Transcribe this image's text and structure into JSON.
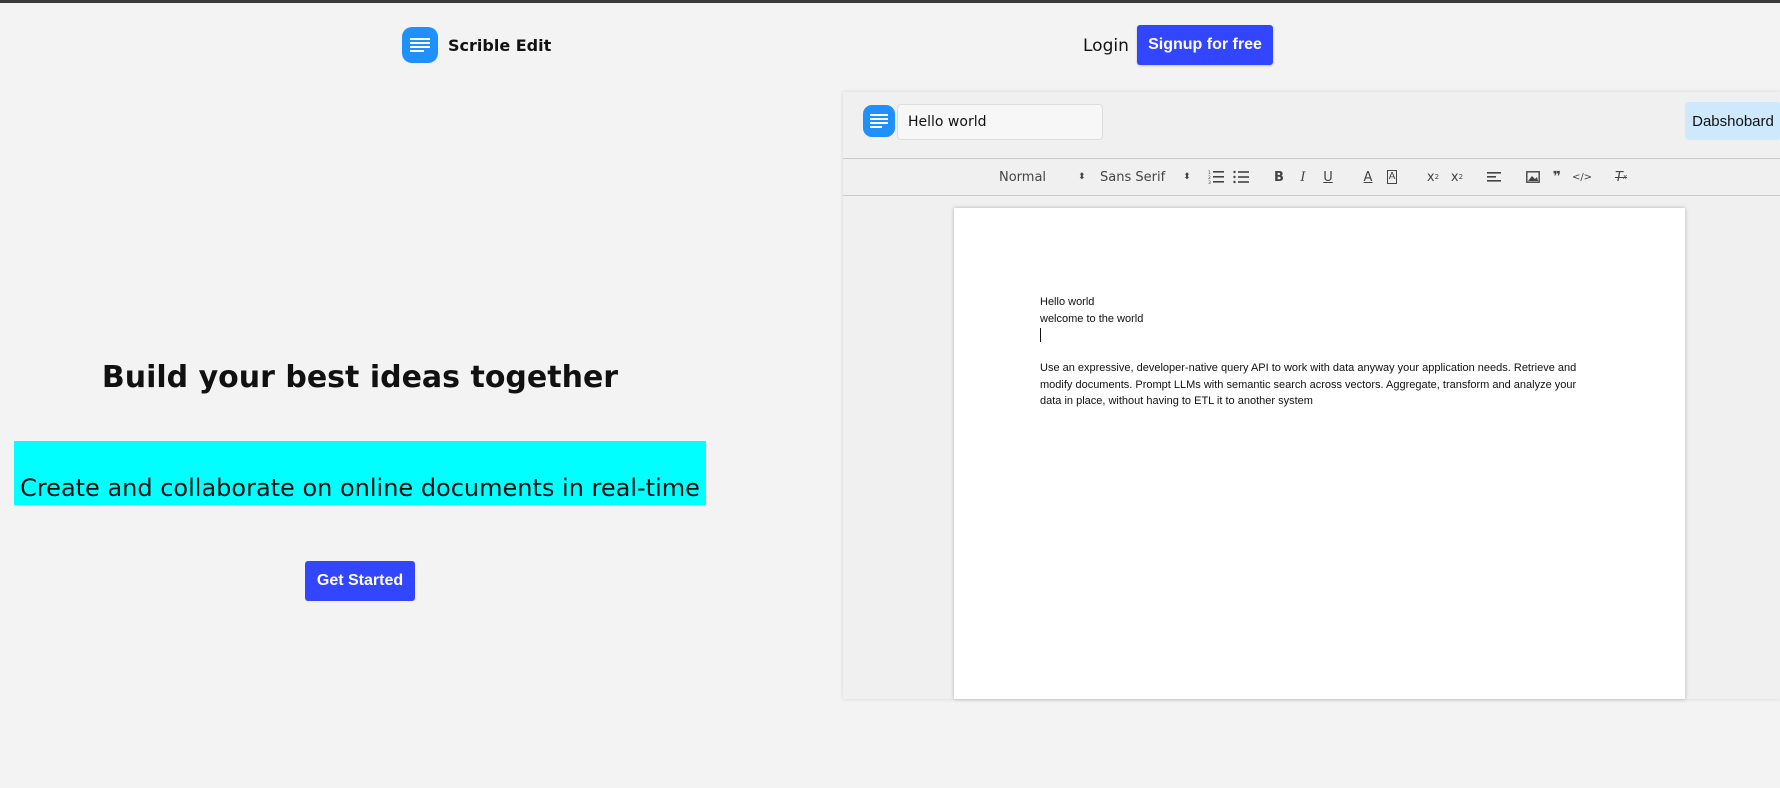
{
  "nav": {
    "brand": "Scrible Edit",
    "login": "Login",
    "signup": "Signup for free"
  },
  "hero": {
    "title": "Build your best ideas together",
    "subtitle": "Create and collaborate on online documents in real-time",
    "cta": "Get Started"
  },
  "editor": {
    "title_value": "Hello world",
    "dashboard": "Dabshobard",
    "toolbar": {
      "heading": "Normal",
      "font": "Sans Serif",
      "icons": [
        "ordered-list-icon",
        "bullet-list-icon",
        "bold-icon",
        "italic-icon",
        "underline-icon",
        "text-color-icon",
        "background-color-icon",
        "subscript-icon",
        "superscript-icon",
        "align-icon",
        "image-icon",
        "blockquote-icon",
        "code-icon",
        "clear-format-icon"
      ]
    },
    "doc": {
      "line1": "Hello world",
      "line2": "welcome to the world",
      "paragraph": "Use an expressive, developer-native query API to work with data anyway your application needs. Retrieve and modify documents. Prompt LLMs with semantic search across vectors. Aggregate, transform and analyze your data in place, without having to ETL it to another system"
    }
  },
  "colors": {
    "accent": "#3346ff",
    "logo": "#1e90ff",
    "highlight": "#00ffff",
    "dashboard_bg": "#cde9fb"
  }
}
